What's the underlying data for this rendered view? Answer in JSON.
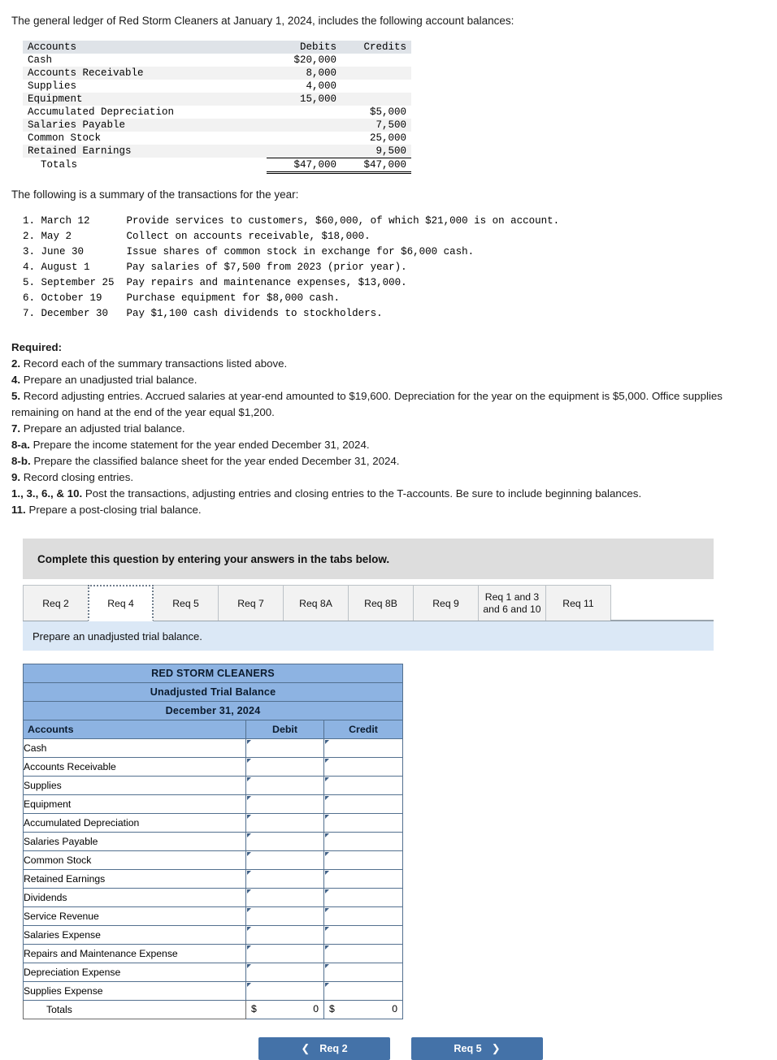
{
  "intro": {
    "line1": "The general ledger of Red Storm Cleaners at January 1, 2024, includes the following account balances:",
    "line2": "The following is a summary of the transactions for the year:"
  },
  "ledger": {
    "headers": [
      "Accounts",
      "Debits",
      "Credits"
    ],
    "rows": [
      {
        "account": "Cash",
        "debit": "$20,000",
        "credit": ""
      },
      {
        "account": "Accounts Receivable",
        "debit": "8,000",
        "credit": ""
      },
      {
        "account": "Supplies",
        "debit": "4,000",
        "credit": ""
      },
      {
        "account": "Equipment",
        "debit": "15,000",
        "credit": ""
      },
      {
        "account": "Accumulated Depreciation",
        "debit": "",
        "credit": "$5,000"
      },
      {
        "account": "Salaries Payable",
        "debit": "",
        "credit": "7,500"
      },
      {
        "account": "Common Stock",
        "debit": "",
        "credit": "25,000"
      },
      {
        "account": "Retained Earnings",
        "debit": "",
        "credit": "9,500"
      }
    ],
    "totals": {
      "account": "Totals",
      "debit": "$47,000",
      "credit": "$47,000"
    }
  },
  "transactions": [
    "1. March 12      Provide services to customers, $60,000, of which $21,000 is on account.",
    "2. May 2         Collect on accounts receivable, $18,000.",
    "3. June 30       Issue shares of common stock in exchange for $6,000 cash.",
    "4. August 1      Pay salaries of $7,500 from 2023 (prior year).",
    "5. September 25  Pay repairs and maintenance expenses, $13,000.",
    "6. October 19    Purchase equipment for $8,000 cash.",
    "7. December 30   Pay $1,100 cash dividends to stockholders."
  ],
  "required": {
    "heading": "Required:",
    "items": [
      {
        "num": "2.",
        "text": " Record each of the summary transactions listed above."
      },
      {
        "num": "4.",
        "text": " Prepare an unadjusted trial balance."
      },
      {
        "num": "5.",
        "text": " Record adjusting entries. Accrued salaries at year-end amounted to $19,600. Depreciation for the year on the equipment is $5,000. Office supplies remaining on hand at the end of the year equal $1,200."
      },
      {
        "num": "7.",
        "text": " Prepare an adjusted trial balance."
      },
      {
        "num": "8-a.",
        "text": " Prepare the income statement for the year ended December 31, 2024."
      },
      {
        "num": "8-b.",
        "text": " Prepare the classified balance sheet for the year ended December 31, 2024."
      },
      {
        "num": "9.",
        "text": " Record closing entries."
      },
      {
        "num": "1., 3., 6., & 10.",
        "text": " Post the transactions, adjusting entries and closing entries to the T-accounts. Be sure to include beginning balances."
      },
      {
        "num": "11.",
        "text": " Prepare a post-closing trial balance."
      }
    ]
  },
  "banner": {
    "complete_text": "Complete this question by entering your answers in the tabs below.",
    "task_text": "Prepare an unadjusted trial balance."
  },
  "tabs": [
    {
      "label": "Req 2",
      "active": false
    },
    {
      "label": "Req 4",
      "active": true
    },
    {
      "label": "Req 5",
      "active": false
    },
    {
      "label": "Req 7",
      "active": false
    },
    {
      "label": "Req 8A",
      "active": false
    },
    {
      "label": "Req 8B",
      "active": false
    },
    {
      "label": "Req 9",
      "active": false
    },
    {
      "label": "Req 1 and 3 and 6 and 10",
      "active": false
    },
    {
      "label": "Req 11",
      "active": false
    }
  ],
  "worksheet": {
    "company": "RED STORM CLEANERS",
    "statement": "Unadjusted Trial Balance",
    "date": "December 31, 2024",
    "col_accounts": "Accounts",
    "col_debit": "Debit",
    "col_credit": "Credit",
    "accounts": [
      "Cash",
      "Accounts Receivable",
      "Supplies",
      "Equipment",
      "Accumulated Depreciation",
      "Salaries Payable",
      "Common Stock",
      "Retained Earnings",
      "Dividends",
      "Service Revenue",
      "Salaries Expense",
      "Repairs and Maintenance Expense",
      "Depreciation Expense",
      "Supplies Expense"
    ],
    "totals_label": "Totals",
    "totals_debit_symbol": "$",
    "totals_debit_value": "0",
    "totals_credit_symbol": "$",
    "totals_credit_value": "0"
  },
  "nav": {
    "prev_label": "Req 2",
    "prev_icon": "chevron-left",
    "next_label": "Req 5",
    "next_icon": "chevron-right"
  },
  "colors": {
    "header_blue": "#8db3e2",
    "banner_blue": "#dbe8f6",
    "banner_grey": "#dddddd",
    "button_blue": "#4472a8",
    "cell_border": "#53708f"
  }
}
